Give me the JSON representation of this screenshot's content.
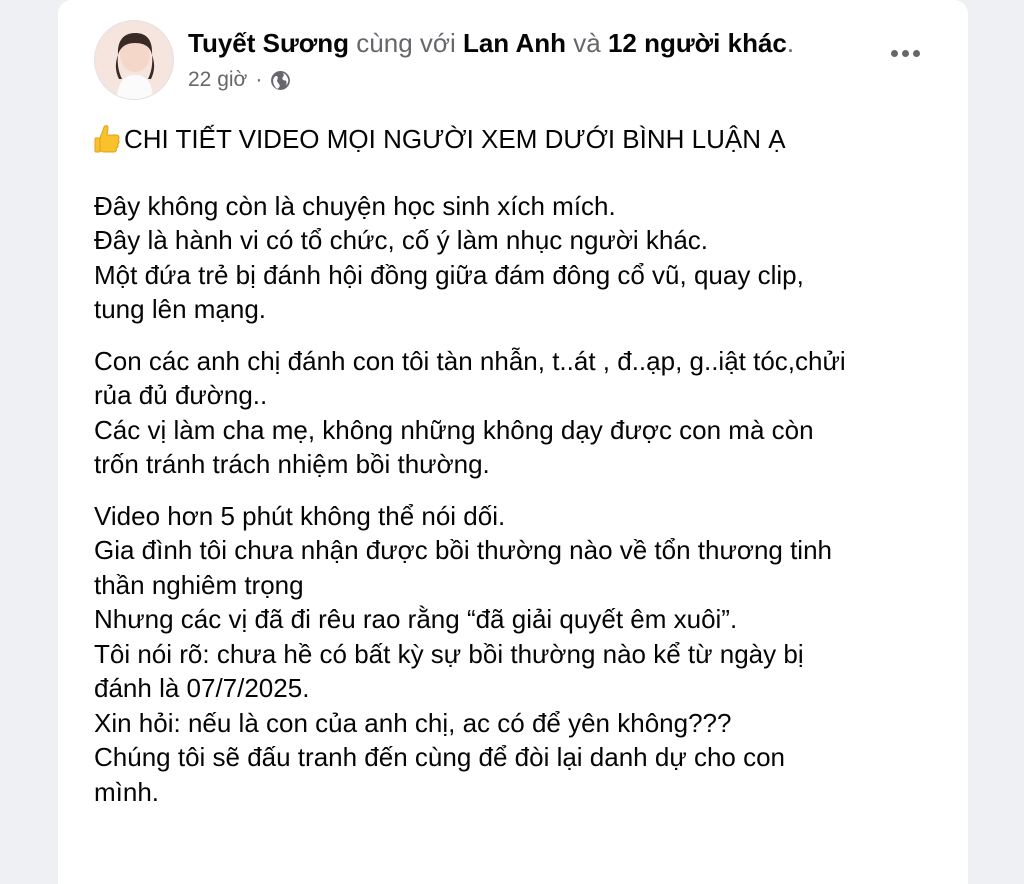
{
  "post": {
    "author": "Tuyết Sương",
    "with_text": "cùng với",
    "tagged_name": "Lan Anh",
    "and_text": "và",
    "others": "12 người khác",
    "period": ".",
    "time": "22 giờ",
    "time_sep": "·",
    "audience_icon": "globe-icon",
    "more_icon": "more-options-icon",
    "headline_icon": "thumbs-up-emoji",
    "headline": "CHI TIẾT VIDEO MỌI NGƯỜI XEM DƯỚI BÌNH LUẬN Ạ",
    "paragraphs": [
      [
        "Đây không còn là chuyện học sinh xích mích.",
        "Đây là hành vi có tổ chức, cố ý làm nhục người khác.",
        "Một đứa trẻ bị đánh hội đồng giữa đám đông cổ vũ, quay clip,",
        "tung lên mạng."
      ],
      [
        "Con các anh chị đánh con tôi tàn nhẫn, t..át , đ..ạp, g..iật tóc,chửi",
        "rủa đủ đường..",
        "Các vị làm cha mẹ, không những không dạy được con mà còn",
        "trốn tránh trách nhiệm bồi thường."
      ],
      [
        "Video hơn 5 phút không thể nói dối.",
        "Gia đình tôi chưa nhận được bồi thường nào về tổn thương tinh",
        "thần nghiêm trọng",
        "Nhưng các vị đã đi rêu rao rằng “đã giải quyết êm xuôi”.",
        "Tôi nói rõ: chưa hề có bất kỳ sự bồi thường nào kể từ ngày bị",
        "đánh là 07/7/2025.",
        "Xin hỏi: nếu là con của anh chị, ac có để yên không???",
        "Chúng tôi sẽ đấu tranh đến cùng để đòi lại danh dự cho con",
        "mình."
      ]
    ]
  }
}
